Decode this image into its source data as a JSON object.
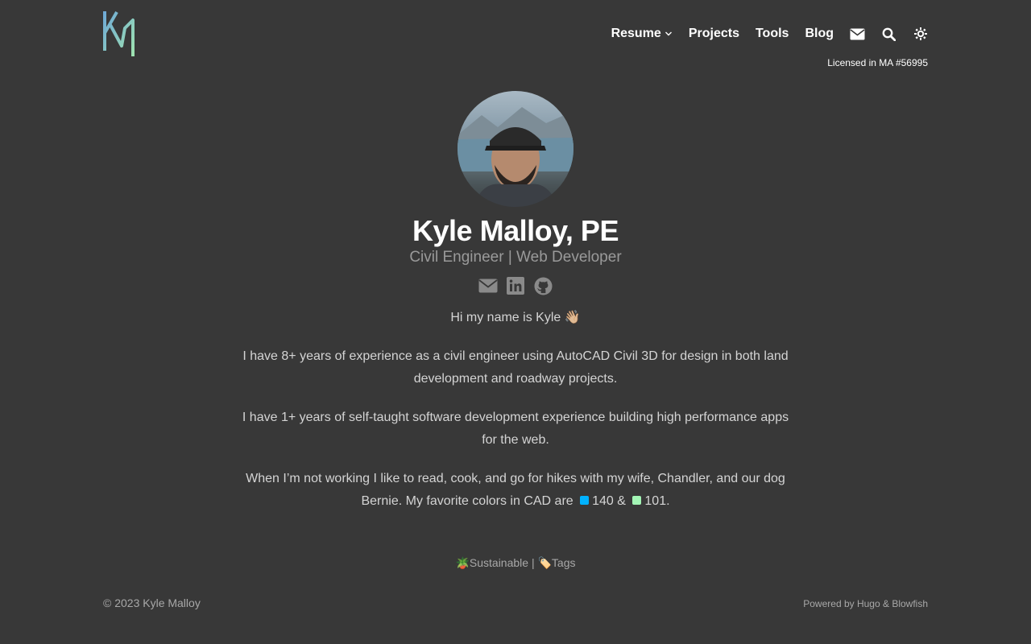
{
  "header": {
    "logo_text": "KM",
    "nav": [
      {
        "label": "Resume"
      },
      {
        "label": "Projects"
      },
      {
        "label": "Tools"
      },
      {
        "label": "Blog"
      }
    ],
    "icons": [
      "envelope-icon",
      "search-icon",
      "theme-toggle-icon"
    ],
    "license": "Licensed in MA #56995"
  },
  "profile": {
    "name": "Kyle Malloy, PE",
    "subtitle": "Civil Engineer | Web Developer",
    "social_icons": [
      "email-icon",
      "linkedin-icon",
      "github-icon"
    ]
  },
  "bio": {
    "greeting": "Hi my name is Kyle 👋🏼",
    "p1": "I have 8+ years of experience as a civil engineer using AutoCAD Civil 3D for design in both land development and roadway projects.",
    "p2": "I have 1+ years of self-taught software development experience building high performance apps for the web.",
    "p3_start": "When I’m not working I like to read, cook, and go for hikes with my wife, Chandler, and our dog Bernie. My favorite colors in CAD are",
    "color1": "140 &",
    "color2": "101.",
    "color1_hex": "#00b2ff",
    "color2_hex": "#a3f5b5"
  },
  "tagline": {
    "sustainable": "🪴Sustainable",
    "separator": " | ",
    "tags": "🏷️Tags"
  },
  "footer": {
    "copyright": "© 2023 Kyle Malloy",
    "powered": "Powered by Hugo & Blowfish"
  }
}
